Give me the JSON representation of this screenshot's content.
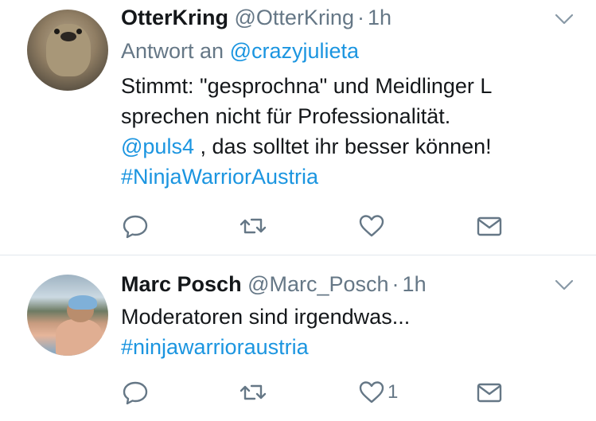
{
  "tweets": [
    {
      "display_name": "OtterKring",
      "handle": "@OtterKring",
      "separator": "·",
      "time": "1h",
      "reply_prefix": "Antwort an",
      "reply_mention": "@crazyjulieta",
      "text_line1": "Stimmt: \"gesprochna\" und Meidlinger L",
      "text_line2": "sprechen nicht für Professionalität.",
      "text_line3_mention": "@puls4",
      "text_line3_rest": " , das solltet ihr besser können!",
      "hashtag": "#NinjaWarriorAustria",
      "like_count": ""
    },
    {
      "display_name": "Marc Posch",
      "handle": "@Marc_Posch",
      "separator": "·",
      "time": "1h",
      "text_line1": "Moderatoren sind irgendwas...",
      "hashtag": "#ninjawarrioraustria",
      "like_count": "1"
    }
  ],
  "icons": {
    "reply": "reply-icon",
    "retweet": "retweet-icon",
    "like": "heart-icon",
    "dm": "envelope-icon",
    "menu": "chevron-down-icon"
  },
  "colors": {
    "link": "#1b95e0",
    "secondary_text": "#657786",
    "icon": "#657786",
    "divider": "#e1e8ed"
  }
}
